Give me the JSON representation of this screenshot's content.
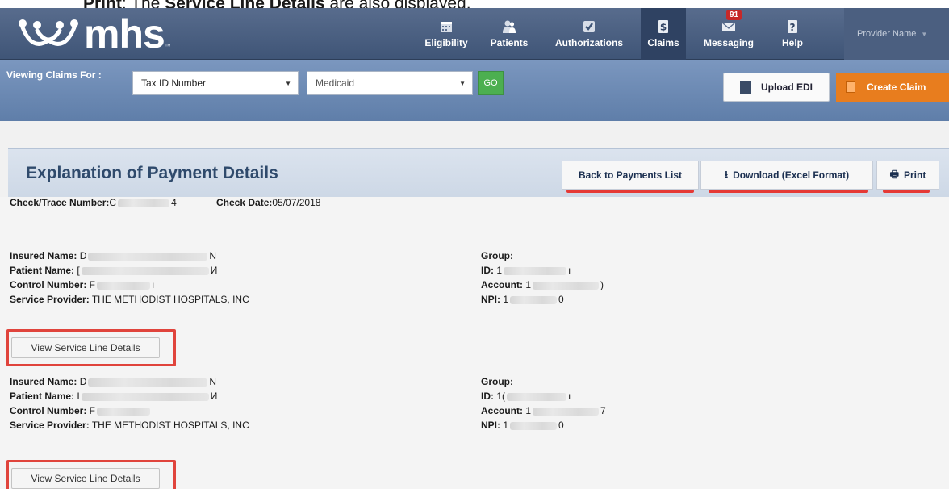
{
  "caption": {
    "lead": "Print",
    "mid": ": The ",
    "emph": "Service Line Details",
    "tail": " are also displayed."
  },
  "nav": {
    "logo": "mhs",
    "items": [
      {
        "label": "Eligibility",
        "icon": "calendar-icon"
      },
      {
        "label": "Patients",
        "icon": "patients-icon"
      },
      {
        "label": "Authorizations",
        "icon": "checkmark-icon"
      },
      {
        "label": "Claims",
        "icon": "dollar-icon"
      },
      {
        "label": "Messaging",
        "icon": "envelope-icon",
        "badge": "91"
      },
      {
        "label": "Help",
        "icon": "question-icon"
      }
    ],
    "provider": "Provider Name"
  },
  "subbar": {
    "label": "Viewing Claims For :",
    "tax_select": "Tax ID Number",
    "plan_select": "Medicaid",
    "go": "GO",
    "upload": "Upload EDI",
    "create": "Create Claim"
  },
  "panel": {
    "title": "Explanation of Payment Details",
    "back": "Back to Payments List",
    "download": "Download (Excel Format)",
    "print": "Print"
  },
  "check": {
    "trace_label": "Check/Trace Number:",
    "trace_prefix": "C",
    "trace_suffix": "4",
    "date_label": "Check Date:",
    "date_value": "05/07/2018"
  },
  "claims": [
    {
      "insured_label": "Insured Name:",
      "insured_a": "D",
      "insured_b": "N",
      "patient_label": "Patient Name:",
      "patient_a": "[",
      "patient_b": "И",
      "control_label": "Control Number:",
      "control_a": "F",
      "control_b": "ı",
      "provider_label": "Service Provider:",
      "provider_value": "THE METHODIST HOSPITALS, INC",
      "group_label": "Group:",
      "id_label": "ID:",
      "id_a": "1",
      "id_b": "ı",
      "account_label": "Account:",
      "account_a": "1",
      "account_b": ")",
      "npi_label": "NPI:",
      "npi_a": "1",
      "npi_b": "0",
      "button": "View Service Line Details"
    },
    {
      "insured_label": "Insured Name:",
      "insured_a": "D",
      "insured_b": "N",
      "patient_label": "Patient Name:",
      "patient_a": "I",
      "patient_b": "И",
      "control_label": "Control Number:",
      "control_a": "F",
      "control_b": "",
      "provider_label": "Service Provider:",
      "provider_value": "THE METHODIST HOSPITALS, INC",
      "group_label": "Group:",
      "id_label": "ID:",
      "id_a": "1(",
      "id_b": "ı",
      "account_label": "Account:",
      "account_a": "1",
      "account_b": "7",
      "npi_label": "NPI:",
      "npi_a": "1",
      "npi_b": "0",
      "button": "View Service Line Details"
    }
  ],
  "colors": {
    "nav": "#3f5577",
    "subbar": "#6d8ab4",
    "create": "#e87d1e",
    "go": "#4caf50",
    "highlight": "#e53935"
  }
}
